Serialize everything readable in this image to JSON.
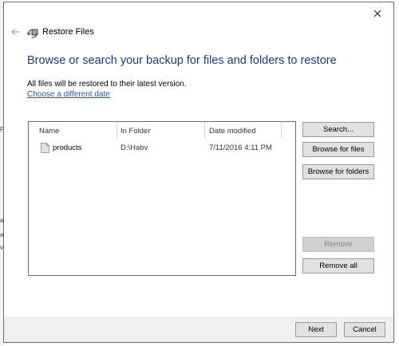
{
  "window": {
    "title": "Restore Files",
    "close_icon": "close-icon",
    "back_icon": "back-arrow-icon",
    "app_icon": "restore-files-icon"
  },
  "main": {
    "heading": "Browse or search your backup for files and folders to restore",
    "info": "All files will be restored to their latest version.",
    "date_link": "Choose a different date"
  },
  "file_list": {
    "columns": [
      "Name",
      "In Folder",
      "Date modified"
    ],
    "rows": [
      {
        "name": "products",
        "folder": "D:\\Habv",
        "date_modified": "7/11/2016 4:11 PM",
        "icon": "file-icon"
      }
    ]
  },
  "buttons": {
    "search": "Search...",
    "browse_files": "Browse for files",
    "browse_folders": "Browse for folders",
    "remove": "Remove",
    "remove_all": "Remove all"
  },
  "footer": {
    "next": "Next",
    "cancel": "Cancel"
  },
  "colors": {
    "heading": "#1e3a78",
    "link": "#2a57a8",
    "button_bg": "#e1e1e1",
    "footer_bg": "#f0f0f0"
  }
}
